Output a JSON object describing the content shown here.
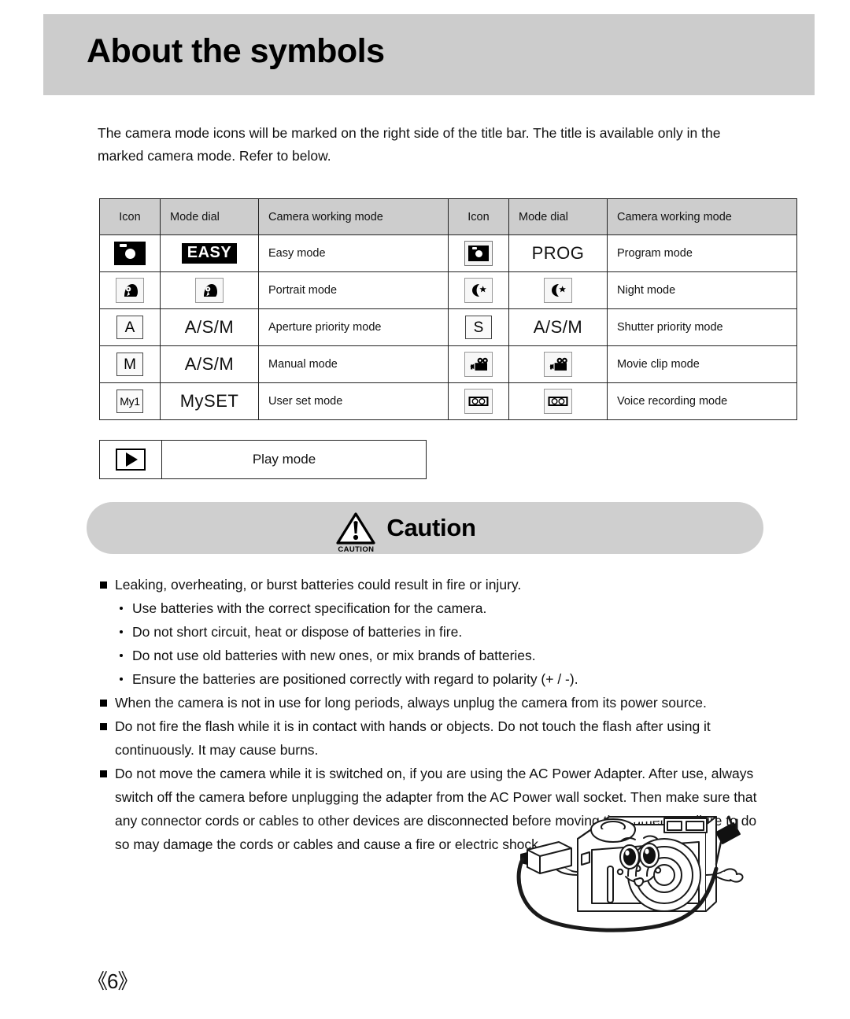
{
  "header": {
    "title": "About the symbols"
  },
  "intro": {
    "text": "The camera mode icons will be marked on the right side of the title bar. The title is available only in the marked camera mode. Refer to below."
  },
  "mode_table": {
    "columns": [
      "Icon",
      "Mode dial",
      "Camera working mode",
      "Icon",
      "Mode dial",
      "Camera working mode"
    ],
    "rows": [
      {
        "left": {
          "icon": "camera-solid-icon",
          "dial_kind": "badge",
          "dial": "EASY",
          "desc": "Easy mode"
        },
        "right": {
          "icon": "camera-framed-icon",
          "dial_kind": "text",
          "dial": "PROG",
          "desc": "Program mode"
        }
      },
      {
        "left": {
          "icon": "portrait-icon",
          "dial_kind": "icon-portrait",
          "dial": "",
          "desc": "Portrait mode"
        },
        "right": {
          "icon": "night-icon",
          "dial_kind": "icon-night",
          "dial": "",
          "desc": "Night mode"
        }
      },
      {
        "left": {
          "icon": "letter-a-icon",
          "dial_kind": "text",
          "dial": "A/S/M",
          "desc": "Aperture priority mode"
        },
        "right": {
          "icon": "letter-s-icon",
          "dial_kind": "text",
          "dial": "A/S/M",
          "desc": "Shutter priority mode"
        }
      },
      {
        "left": {
          "icon": "letter-m-icon",
          "dial_kind": "text",
          "dial": "A/S/M",
          "desc": "Manual mode"
        },
        "right": {
          "icon": "movie-icon",
          "dial_kind": "icon-movie",
          "dial": "",
          "desc": "Movie clip mode"
        }
      },
      {
        "left": {
          "icon": "my1-icon",
          "dial_kind": "text",
          "dial": "MySET",
          "desc": "User set mode"
        },
        "right": {
          "icon": "voice-icon",
          "dial_kind": "icon-voice",
          "dial": "",
          "desc": "Voice recording mode"
        }
      }
    ],
    "icon_letters": {
      "a": "A",
      "s": "S",
      "m": "M",
      "my1": "My1"
    }
  },
  "play_row": {
    "icon": "play-icon",
    "label": "Play mode"
  },
  "caution": {
    "mark_label": "CAUTION",
    "title": "Caution",
    "notes": [
      {
        "type": "square",
        "text": "Leaking, overheating, or burst batteries could result in fire or injury.",
        "narrow": false
      },
      {
        "type": "dot",
        "text": "Use batteries with the correct specification for the camera.",
        "narrow": false
      },
      {
        "type": "dot",
        "text": "Do not short circuit, heat or dispose of batteries in fire.",
        "narrow": false
      },
      {
        "type": "dot",
        "text": "Do not use old batteries with new ones, or mix brands of batteries.",
        "narrow": false
      },
      {
        "type": "dot",
        "text": "Ensure the batteries are positioned correctly with regard to polarity (+ / -).",
        "narrow": false
      },
      {
        "type": "square",
        "text": "When the camera is not in use for long periods, always unplug the camera from its power source.",
        "narrow": false
      },
      {
        "type": "square",
        "text": "Do not fire the flash while it is in contact with hands or objects. Do not touch the flash after using it continuously. It may cause burns.",
        "narrow": false
      },
      {
        "type": "square",
        "text": "Do not move the camera while it is switched on, if you are using the AC Power Adapter. After use, always switch off the camera before unplugging the adapter from the AC Power wall socket. Then make sure that any connector cords or cables to other devices are disconnected before moving the camera. Failure to do so may damage the cords or cables and cause a fire or electric shock.",
        "narrow": false
      }
    ]
  },
  "illustration": {
    "name": "camera-character-with-ac-adapter-illustration"
  },
  "footer": {
    "page_number": "《6》"
  },
  "colors": {
    "header_bg": "#cccccc",
    "table_header_bg": "#cdcdcd",
    "banner_bg": "#cfcfcf",
    "text": "#111111",
    "border": "#222222"
  }
}
